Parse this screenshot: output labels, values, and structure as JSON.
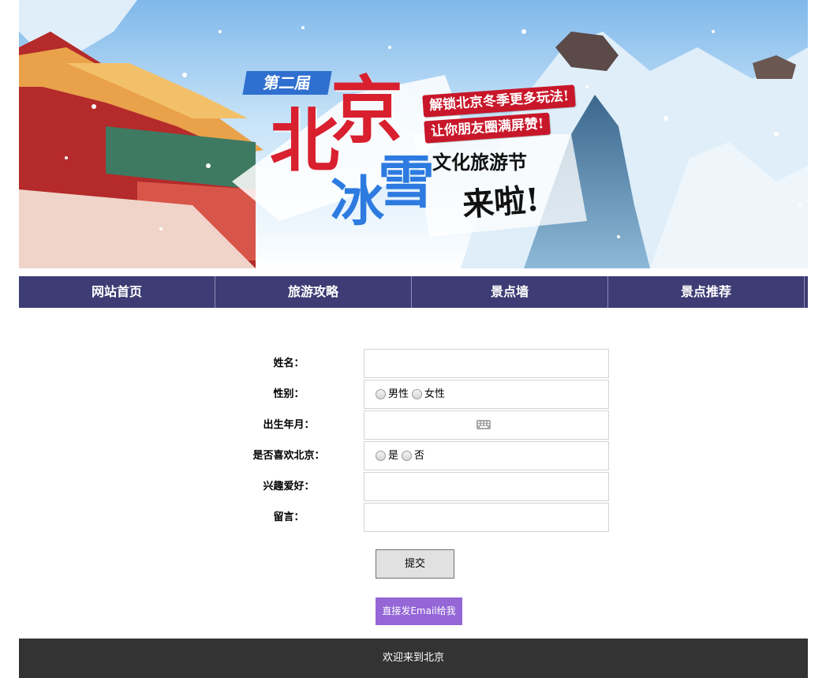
{
  "banner": {
    "badge": "第二届",
    "title_char1": "北",
    "title_char2": "京",
    "subtitle_char1": "冰",
    "subtitle_char2": "雪",
    "slogan1": "解锁北京冬季更多玩法!",
    "slogan2": "让你朋友圈满屏赞!",
    "festival": "文化旅游节",
    "comes": "来啦!"
  },
  "nav": {
    "items": [
      {
        "label": "网站首页"
      },
      {
        "label": "旅游攻略"
      },
      {
        "label": "景点墙"
      },
      {
        "label": "景点推荐"
      }
    ]
  },
  "form": {
    "name_label": "姓名：",
    "name_value": "",
    "gender_label": "性别：",
    "gender_options": [
      "男性",
      "女性"
    ],
    "birth_label": "出生年月：",
    "birth_value": "",
    "like_label": "是否喜欢北京：",
    "like_options": [
      "是",
      "否"
    ],
    "hobby_label": "兴趣爱好：",
    "hobby_value": "",
    "message_label": "留言：",
    "message_value": "",
    "submit_label": "提交",
    "email_label": "直接发Email给我"
  },
  "footer": {
    "text": "欢迎来到北京"
  },
  "colors": {
    "nav_bg": "#3d3c74",
    "email_button": "#9466d6",
    "footer_bg": "#333333",
    "title_red": "#d8202f",
    "title_blue": "#2d7be0"
  }
}
